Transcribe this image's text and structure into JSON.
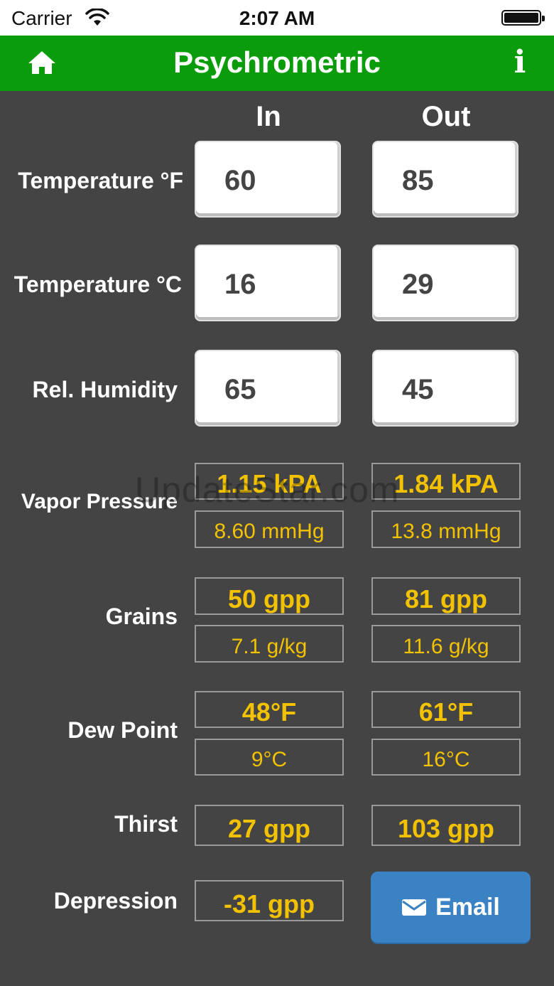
{
  "status_bar": {
    "carrier": "Carrier",
    "time": "2:07 AM"
  },
  "nav": {
    "title": "Psychrometric",
    "home_icon": "home-icon",
    "info_icon": "info-icon",
    "info_glyph": "i"
  },
  "columns": {
    "in": "In",
    "out": "Out"
  },
  "inputs": [
    {
      "label": "Temperature °F",
      "in": "60",
      "out": "85"
    },
    {
      "label": "Temperature °C",
      "in": "16",
      "out": "29"
    },
    {
      "label": "Rel. Humidity",
      "in": "65",
      "out": "45"
    }
  ],
  "outputs": {
    "vapor_pressure": {
      "label": "Vapor Pressure",
      "in_primary": "1.15 kPA",
      "in_secondary": "8.60 mmHg",
      "out_primary": "1.84 kPA",
      "out_secondary": "13.8 mmHg"
    },
    "grains": {
      "label": "Grains",
      "in_primary": "50 gpp",
      "in_secondary": "7.1 g/kg",
      "out_primary": "81 gpp",
      "out_secondary": "11.6 g/kg"
    },
    "dew_point": {
      "label": "Dew Point",
      "in_primary": "48°F",
      "in_secondary": "9°C",
      "out_primary": "61°F",
      "out_secondary": "16°C"
    },
    "thirst": {
      "label": "Thirst",
      "in": "27 gpp",
      "out": "103 gpp"
    },
    "depression": {
      "label": "Depression",
      "in": "-31 gpp"
    }
  },
  "email_button": {
    "label": "Email",
    "icon": "envelope-icon"
  },
  "watermark": "UpdateStar.com",
  "colors": {
    "nav": "#0a9c0a",
    "background": "#444444",
    "value_text": "#f2c200",
    "email_button": "#3b82c4"
  }
}
